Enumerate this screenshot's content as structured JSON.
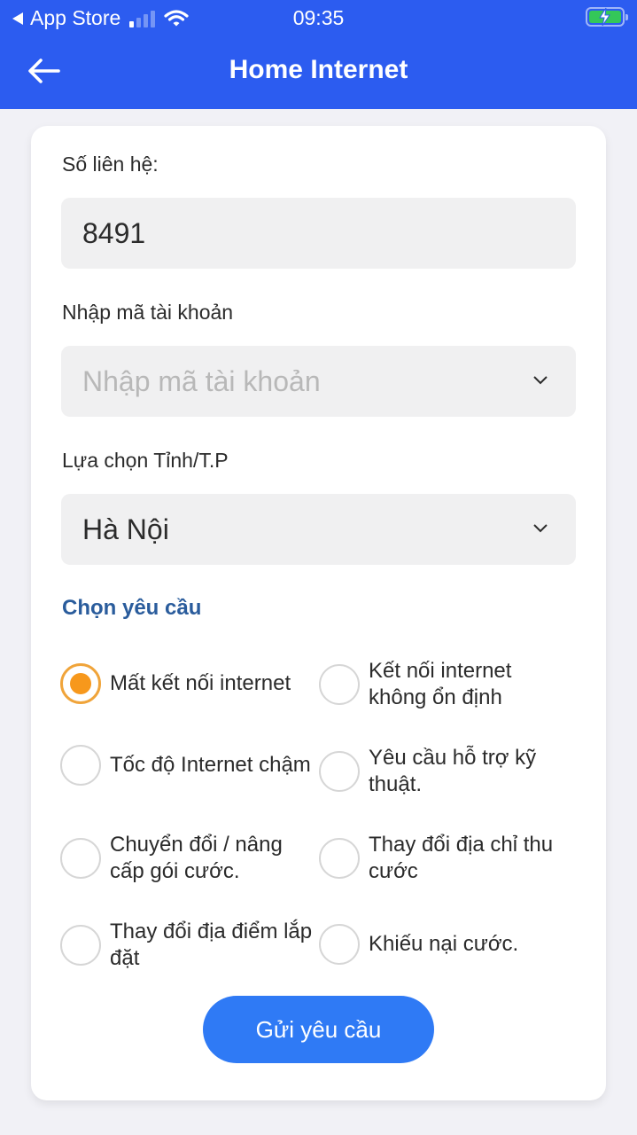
{
  "status_bar": {
    "back_app": "App Store",
    "time": "09:35",
    "battery_charging": true
  },
  "header": {
    "title": "Home Internet",
    "back_icon": "arrow-left-icon"
  },
  "form": {
    "contact": {
      "label": "Số liên hệ:",
      "value": "8491"
    },
    "account": {
      "label": "Nhập mã tài khoản",
      "placeholder": "Nhập mã tài khoản",
      "value": ""
    },
    "province": {
      "label": "Lựa chọn Tỉnh/T.P",
      "value": "Hà Nội"
    },
    "request_section_title": "Chọn yêu cầu",
    "options": [
      {
        "label": "Mất kết nối internet",
        "checked": true
      },
      {
        "label": "Kết nối internet không ổn định",
        "checked": false
      },
      {
        "label": "Tốc độ Internet chậm",
        "checked": false
      },
      {
        "label": "Yêu cầu hỗ trợ kỹ thuật.",
        "checked": false
      },
      {
        "label": "Chuyển đổi / nâng cấp gói cước.",
        "checked": false
      },
      {
        "label": "Thay đổi địa chỉ thu cước",
        "checked": false
      },
      {
        "label": "Thay đổi địa điểm lắp đặt",
        "checked": false
      },
      {
        "label": "Khiếu nại cước.",
        "checked": false
      }
    ],
    "submit_label": "Gửi yêu cầu"
  },
  "colors": {
    "header": "#2c5cf0",
    "accent_button": "#2f7af5",
    "radio_selected": "#f7981c",
    "section_title": "#2a5c9c"
  }
}
